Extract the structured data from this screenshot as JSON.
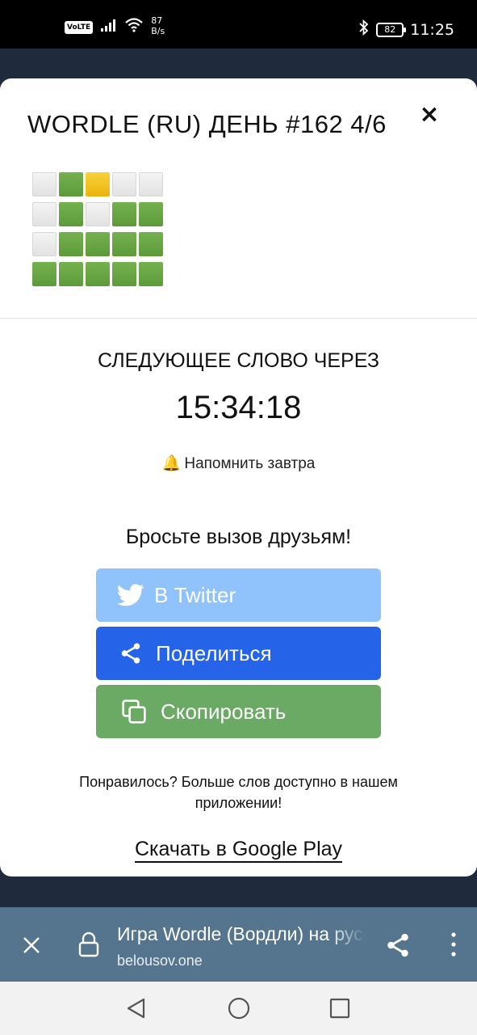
{
  "status_bar": {
    "volte": "VoLTE",
    "net_speed_value": "87",
    "net_speed_unit": "B/s",
    "battery": "82",
    "time": "11:25"
  },
  "modal": {
    "title": "WORDLE (RU) ДЕНЬ #162 4/6",
    "close": "×",
    "result_grid": [
      [
        "absent",
        "correct",
        "present",
        "absent",
        "absent"
      ],
      [
        "absent",
        "correct",
        "absent",
        "correct",
        "correct"
      ],
      [
        "absent",
        "correct",
        "correct",
        "correct",
        "correct"
      ],
      [
        "correct",
        "correct",
        "correct",
        "correct",
        "correct"
      ]
    ],
    "next_word_label": "СЛЕДУЮЩЕЕ СЛОВО ЧЕРЕЗ",
    "countdown": "15:34:18",
    "remind_label": "Напомнить завтра",
    "challenge_label": "Бросьте вызов друзьям!",
    "buttons": {
      "twitter": "В Twitter",
      "share": "Поделиться",
      "copy": "Скопировать"
    },
    "promo_text": "Понравилось? Больше слов доступно в нашем приложении!",
    "google_play_link": "Скачать в Google Play"
  },
  "browser_bar": {
    "page_title": "Игра Wordle (Вордли) на русском",
    "url": "belousov.one"
  },
  "colors": {
    "correct": "#6aaa64",
    "present": "#f0bf1f",
    "twitter": "#90c3fb",
    "share": "#2563e8",
    "copy": "#6aaa64",
    "browser_bar": "#54758d"
  }
}
